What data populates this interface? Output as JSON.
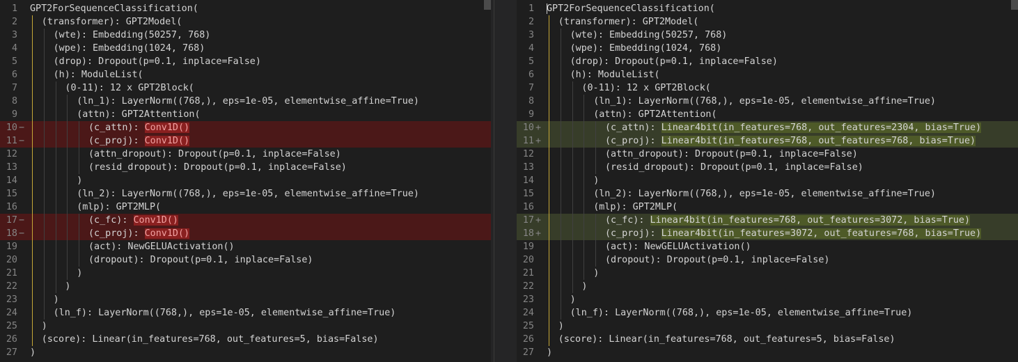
{
  "left_pane": {
    "lines": [
      {
        "num": "1",
        "mark": "",
        "depth": 0,
        "segments": [
          {
            "t": "GPT2ForSequenceClassification("
          }
        ]
      },
      {
        "num": "2",
        "mark": "",
        "depth": 1,
        "segments": [
          {
            "t": "(transformer): GPT2Model("
          }
        ]
      },
      {
        "num": "3",
        "mark": "",
        "depth": 2,
        "segments": [
          {
            "t": "(wte): Embedding(50257, 768)"
          }
        ]
      },
      {
        "num": "4",
        "mark": "",
        "depth": 2,
        "segments": [
          {
            "t": "(wpe): Embedding(1024, 768)"
          }
        ]
      },
      {
        "num": "5",
        "mark": "",
        "depth": 2,
        "segments": [
          {
            "t": "(drop): Dropout(p=0.1, inplace=False)"
          }
        ]
      },
      {
        "num": "6",
        "mark": "",
        "depth": 2,
        "segments": [
          {
            "t": "(h): ModuleList("
          }
        ]
      },
      {
        "num": "7",
        "mark": "",
        "depth": 3,
        "segments": [
          {
            "t": "(0-11): 12 x GPT2Block("
          }
        ]
      },
      {
        "num": "8",
        "mark": "",
        "depth": 4,
        "segments": [
          {
            "t": "(ln_1): LayerNorm((768,), eps=1e-05, elementwise_affine=True)"
          }
        ]
      },
      {
        "num": "9",
        "mark": "",
        "depth": 4,
        "segments": [
          {
            "t": "(attn): GPT2Attention("
          }
        ]
      },
      {
        "num": "10",
        "mark": "−",
        "depth": 5,
        "status": "del",
        "segments": [
          {
            "t": "(c_attn): "
          },
          {
            "t": "Conv1D()",
            "hl": true
          }
        ]
      },
      {
        "num": "11",
        "mark": "−",
        "depth": 5,
        "status": "del",
        "segments": [
          {
            "t": "(c_proj): "
          },
          {
            "t": "Conv1D()",
            "hl": true
          }
        ]
      },
      {
        "num": "12",
        "mark": "",
        "depth": 5,
        "segments": [
          {
            "t": "(attn_dropout): Dropout(p=0.1, inplace=False)"
          }
        ]
      },
      {
        "num": "13",
        "mark": "",
        "depth": 5,
        "segments": [
          {
            "t": "(resid_dropout): Dropout(p=0.1, inplace=False)"
          }
        ]
      },
      {
        "num": "14",
        "mark": "",
        "depth": 4,
        "segments": [
          {
            "t": ")"
          }
        ]
      },
      {
        "num": "15",
        "mark": "",
        "depth": 4,
        "segments": [
          {
            "t": "(ln_2): LayerNorm((768,), eps=1e-05, elementwise_affine=True)"
          }
        ]
      },
      {
        "num": "16",
        "mark": "",
        "depth": 4,
        "segments": [
          {
            "t": "(mlp): GPT2MLP("
          }
        ]
      },
      {
        "num": "17",
        "mark": "−",
        "depth": 5,
        "status": "del",
        "segments": [
          {
            "t": "(c_fc): "
          },
          {
            "t": "Conv1D()",
            "hl": true
          }
        ]
      },
      {
        "num": "18",
        "mark": "−",
        "depth": 5,
        "status": "del",
        "segments": [
          {
            "t": "(c_proj): "
          },
          {
            "t": "Conv1D()",
            "hl": true
          }
        ]
      },
      {
        "num": "19",
        "mark": "",
        "depth": 5,
        "segments": [
          {
            "t": "(act): NewGELUActivation()"
          }
        ]
      },
      {
        "num": "20",
        "mark": "",
        "depth": 5,
        "segments": [
          {
            "t": "(dropout): Dropout(p=0.1, inplace=False)"
          }
        ]
      },
      {
        "num": "21",
        "mark": "",
        "depth": 4,
        "segments": [
          {
            "t": ")"
          }
        ]
      },
      {
        "num": "22",
        "mark": "",
        "depth": 3,
        "segments": [
          {
            "t": ")"
          }
        ]
      },
      {
        "num": "23",
        "mark": "",
        "depth": 2,
        "segments": [
          {
            "t": ")"
          }
        ]
      },
      {
        "num": "24",
        "mark": "",
        "depth": 2,
        "segments": [
          {
            "t": "(ln_f): LayerNorm((768,), eps=1e-05, elementwise_affine=True)"
          }
        ]
      },
      {
        "num": "25",
        "mark": "",
        "depth": 1,
        "segments": [
          {
            "t": ")"
          }
        ]
      },
      {
        "num": "26",
        "mark": "",
        "depth": 1,
        "segments": [
          {
            "t": "(score): Linear(in_features=768, out_features=5, bias=False)"
          }
        ]
      },
      {
        "num": "27",
        "mark": "",
        "depth": 0,
        "segments": [
          {
            "t": ")"
          }
        ]
      }
    ]
  },
  "right_pane": {
    "lines": [
      {
        "num": "1",
        "mark": "",
        "depth": 0,
        "cursor": true,
        "segments": [
          {
            "t": "GPT2ForSequenceClassification("
          }
        ]
      },
      {
        "num": "2",
        "mark": "",
        "depth": 1,
        "segments": [
          {
            "t": "(transformer): GPT2Model("
          }
        ]
      },
      {
        "num": "3",
        "mark": "",
        "depth": 2,
        "segments": [
          {
            "t": "(wte): Embedding(50257, 768)"
          }
        ]
      },
      {
        "num": "4",
        "mark": "",
        "depth": 2,
        "segments": [
          {
            "t": "(wpe): Embedding(1024, 768)"
          }
        ]
      },
      {
        "num": "5",
        "mark": "",
        "depth": 2,
        "segments": [
          {
            "t": "(drop): Dropout(p=0.1, inplace=False)"
          }
        ]
      },
      {
        "num": "6",
        "mark": "",
        "depth": 2,
        "segments": [
          {
            "t": "(h): ModuleList("
          }
        ]
      },
      {
        "num": "7",
        "mark": "",
        "depth": 3,
        "segments": [
          {
            "t": "(0-11): 12 x GPT2Block("
          }
        ]
      },
      {
        "num": "8",
        "mark": "",
        "depth": 4,
        "segments": [
          {
            "t": "(ln_1): LayerNorm((768,), eps=1e-05, elementwise_affine=True)"
          }
        ]
      },
      {
        "num": "9",
        "mark": "",
        "depth": 4,
        "segments": [
          {
            "t": "(attn): GPT2Attention("
          }
        ]
      },
      {
        "num": "10",
        "mark": "+",
        "depth": 5,
        "status": "ins",
        "segments": [
          {
            "t": "(c_attn): "
          },
          {
            "t": "Linear4bit(in_features=768, out_features=2304, bias=True)",
            "hl": true
          }
        ]
      },
      {
        "num": "11",
        "mark": "+",
        "depth": 5,
        "status": "ins",
        "segments": [
          {
            "t": "(c_proj): "
          },
          {
            "t": "Linear4bit(in_features=768, out_features=768, bias=True)",
            "hl": true
          }
        ]
      },
      {
        "num": "12",
        "mark": "",
        "depth": 5,
        "segments": [
          {
            "t": "(attn_dropout): Dropout(p=0.1, inplace=False)"
          }
        ]
      },
      {
        "num": "13",
        "mark": "",
        "depth": 5,
        "segments": [
          {
            "t": "(resid_dropout): Dropout(p=0.1, inplace=False)"
          }
        ]
      },
      {
        "num": "14",
        "mark": "",
        "depth": 4,
        "segments": [
          {
            "t": ")"
          }
        ]
      },
      {
        "num": "15",
        "mark": "",
        "depth": 4,
        "segments": [
          {
            "t": "(ln_2): LayerNorm((768,), eps=1e-05, elementwise_affine=True)"
          }
        ]
      },
      {
        "num": "16",
        "mark": "",
        "depth": 4,
        "segments": [
          {
            "t": "(mlp): GPT2MLP("
          }
        ]
      },
      {
        "num": "17",
        "mark": "+",
        "depth": 5,
        "status": "ins",
        "segments": [
          {
            "t": "(c_fc): "
          },
          {
            "t": "Linear4bit(in_features=768, out_features=3072, bias=True)",
            "hl": true
          }
        ]
      },
      {
        "num": "18",
        "mark": "+",
        "depth": 5,
        "status": "ins",
        "segments": [
          {
            "t": "(c_proj): "
          },
          {
            "t": "Linear4bit(in_features=3072, out_features=768, bias=True)",
            "hl": true
          }
        ]
      },
      {
        "num": "19",
        "mark": "",
        "depth": 5,
        "segments": [
          {
            "t": "(act): NewGELUActivation()"
          }
        ]
      },
      {
        "num": "20",
        "mark": "",
        "depth": 5,
        "segments": [
          {
            "t": "(dropout): Dropout(p=0.1, inplace=False)"
          }
        ]
      },
      {
        "num": "21",
        "mark": "",
        "depth": 4,
        "segments": [
          {
            "t": ")"
          }
        ]
      },
      {
        "num": "22",
        "mark": "",
        "depth": 3,
        "segments": [
          {
            "t": ")"
          }
        ]
      },
      {
        "num": "23",
        "mark": "",
        "depth": 2,
        "segments": [
          {
            "t": ")"
          }
        ]
      },
      {
        "num": "24",
        "mark": "",
        "depth": 2,
        "segments": [
          {
            "t": "(ln_f): LayerNorm((768,), eps=1e-05, elementwise_affine=True)"
          }
        ]
      },
      {
        "num": "25",
        "mark": "",
        "depth": 1,
        "segments": [
          {
            "t": ")"
          }
        ]
      },
      {
        "num": "26",
        "mark": "",
        "depth": 1,
        "segments": [
          {
            "t": "(score): Linear(in_features=768, out_features=5, bias=False)"
          }
        ]
      },
      {
        "num": "27",
        "mark": "",
        "depth": 0,
        "segments": [
          {
            "t": ")"
          }
        ]
      }
    ]
  },
  "colors": {
    "background": "#1e1e1e",
    "removed_line": "#4b1818",
    "removed_token": "#8a2020",
    "added_line": "#373d29",
    "added_token": "#4e5a28",
    "indent_guide_active": "#c7a837"
  }
}
